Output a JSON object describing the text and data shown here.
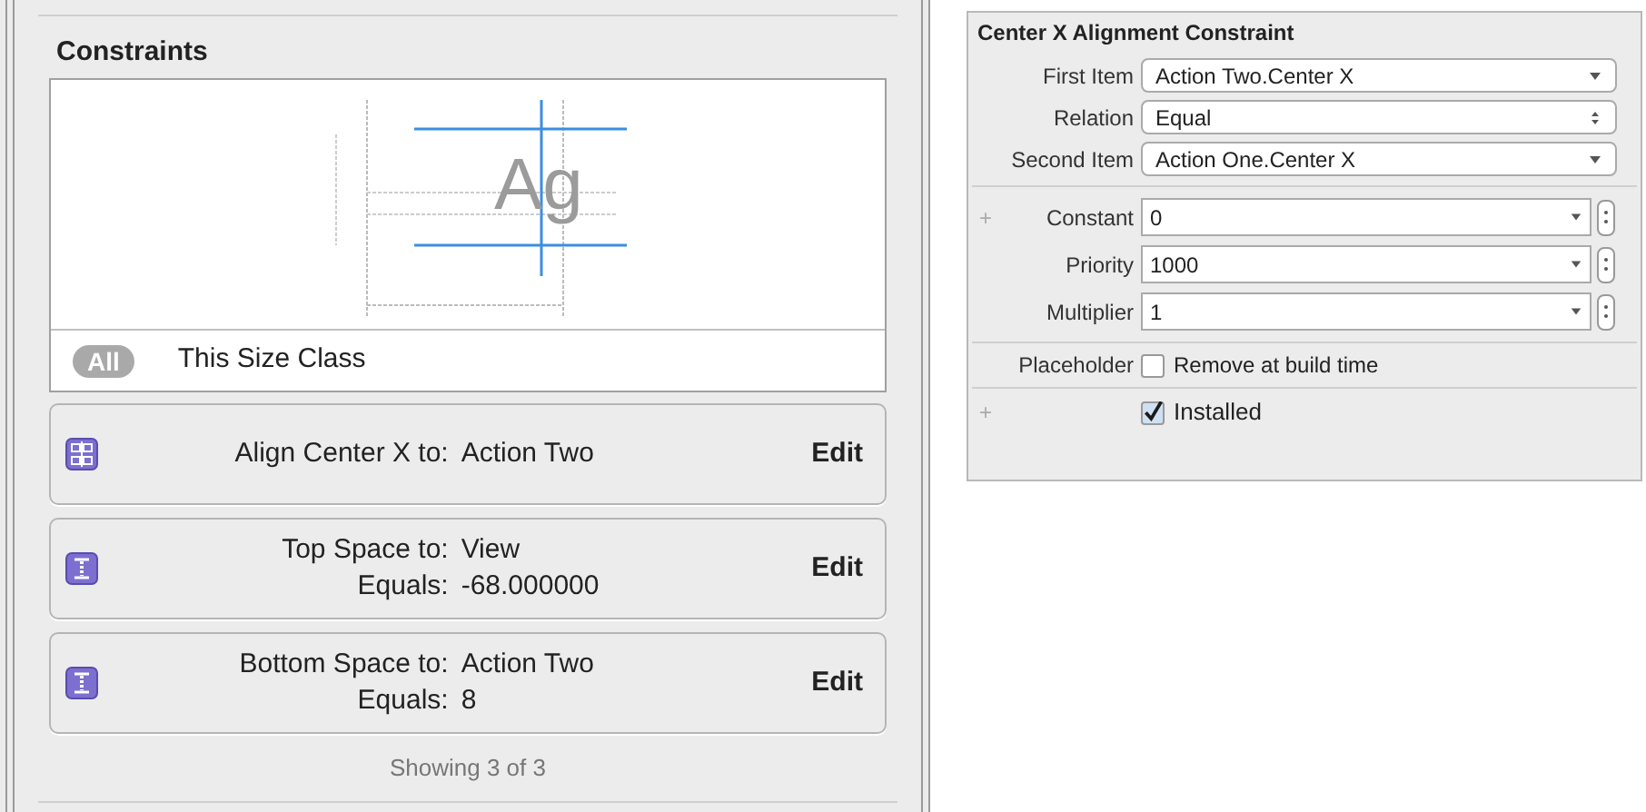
{
  "constraints_panel": {
    "title": "Constraints",
    "preview_text": "Ag",
    "size_class": {
      "pill": "All",
      "label": "This Size Class"
    },
    "constraints": [
      {
        "kind": "align",
        "lines": [
          {
            "label": "Align Center X to:",
            "value": "Action Two"
          }
        ],
        "edit": "Edit"
      },
      {
        "kind": "space",
        "lines": [
          {
            "label": "Top Space to:",
            "value": "View"
          },
          {
            "label": "Equals:",
            "value": "-68.000000"
          }
        ],
        "edit": "Edit"
      },
      {
        "kind": "space",
        "lines": [
          {
            "label": "Bottom Space to:",
            "value": "Action Two"
          },
          {
            "label": "Equals:",
            "value": "8"
          }
        ],
        "edit": "Edit"
      }
    ],
    "footer": "Showing 3 of 3"
  },
  "inspector": {
    "title": "Center X Alignment Constraint",
    "popups": [
      {
        "label": "First Item",
        "value": "Action Two.Center X",
        "kind": "pulldown"
      },
      {
        "label": "Relation",
        "value": "Equal",
        "kind": "popup"
      },
      {
        "label": "Second Item",
        "value": "Action One.Center X",
        "kind": "pulldown"
      }
    ],
    "fields": [
      {
        "label": "Constant",
        "value": "0",
        "add_mark": "+"
      },
      {
        "label": "Priority",
        "value": "1000"
      },
      {
        "label": "Multiplier",
        "value": "1"
      }
    ],
    "placeholder": {
      "label": "Placeholder",
      "option": "Remove at build time",
      "checked": false
    },
    "installed": {
      "add_mark": "+",
      "label": "Installed",
      "checked": true
    }
  }
}
